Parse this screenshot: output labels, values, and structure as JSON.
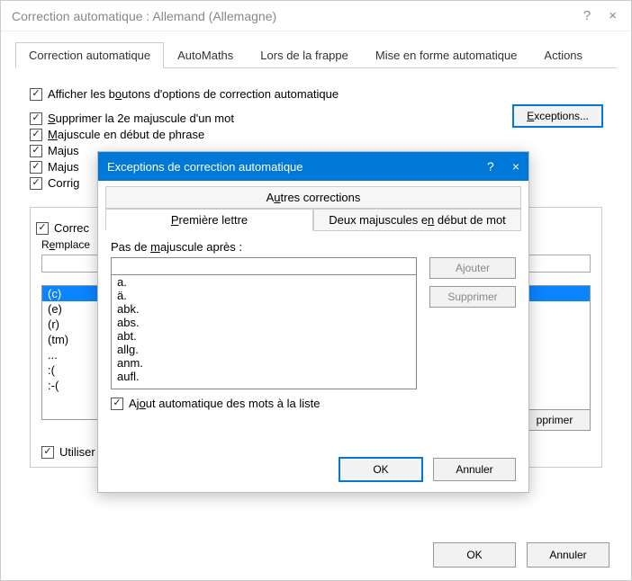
{
  "main": {
    "title": "Correction automatique : Allemand (Allemagne)",
    "help_icon": "?",
    "close_icon": "×",
    "tabs": [
      "Correction automatique",
      "AutoMaths",
      "Lors de la frappe",
      "Mise en forme automatique",
      "Actions"
    ],
    "checks": {
      "show_buttons": "Afficher les boutons d'options de correction automatique",
      "suppress_second_cap": "Supprimer la 2e majuscule d'un mot",
      "cap_sentence": "Majuscule en début de phrase",
      "cap_partial1": "Majus",
      "cap_partial2": "Majus",
      "corrig": "Corrig",
      "use_spell": "Utiliser automatiquement les suggestions du vérificateur d'orthographe"
    },
    "exceptions_btn": "Exceptions...",
    "correc_check": "Correc",
    "replace_label": "Remplace",
    "list": [
      "(c)",
      "(e)",
      "(r)",
      "(tm)",
      "...",
      ":(",
      ":-("
    ],
    "supprimer_btn": "pprimer",
    "ok": "OK",
    "cancel": "Annuler"
  },
  "modal": {
    "title": "Exceptions de correction automatique",
    "help_icon": "?",
    "close_icon": "×",
    "tab_other": "Autres corrections",
    "tab_first": "Première lettre",
    "tab_two_caps": "Deux majuscules en début de mot",
    "label": "Pas de majuscule après :",
    "input_value": "",
    "add_btn": "Ajouter",
    "delete_btn": "Supprimer",
    "list": [
      "a.",
      "ä.",
      "abk.",
      "abs.",
      "abt.",
      "allg.",
      "anm.",
      "aufl."
    ],
    "auto_add_check": "Ajout automatique des mots à la liste",
    "ok": "OK",
    "cancel": "Annuler"
  }
}
